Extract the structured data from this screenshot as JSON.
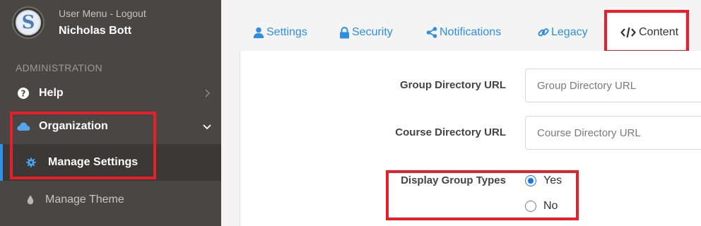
{
  "sidebar": {
    "avatar_letter": "S",
    "user_menu": "User Menu - Logout",
    "user_name": "Nicholas Bott",
    "section_title": "ADMINISTRATION",
    "items": [
      {
        "label": "Help",
        "icon": "question-circle-icon"
      },
      {
        "label": "Organization",
        "icon": "cloud-icon"
      }
    ],
    "subitems": [
      {
        "label": "Manage Settings",
        "icon": "gear-icon",
        "active": true
      },
      {
        "label": "Manage Theme",
        "icon": "droplet-icon",
        "active": false
      }
    ],
    "colors": {
      "background": "#4a4643",
      "active_bar": "#2e90e6",
      "highlight": "#e5202b"
    }
  },
  "tabs": [
    {
      "label": "Settings",
      "icon": "user-icon"
    },
    {
      "label": "Security",
      "icon": "lock-icon"
    },
    {
      "label": "Notifications",
      "icon": "share-icon"
    },
    {
      "label": "Legacy",
      "icon": "link-icon"
    },
    {
      "label": "Content",
      "icon": "code-icon",
      "active": true
    }
  ],
  "form": {
    "group_directory": {
      "label": "Group Directory URL",
      "placeholder": "Group Directory URL",
      "value": ""
    },
    "course_directory": {
      "label": "Course Directory URL",
      "placeholder": "Course Directory URL",
      "value": ""
    },
    "display_group_types": {
      "label": "Display Group Types",
      "options": [
        "Yes",
        "No"
      ],
      "selected": "Yes"
    }
  }
}
